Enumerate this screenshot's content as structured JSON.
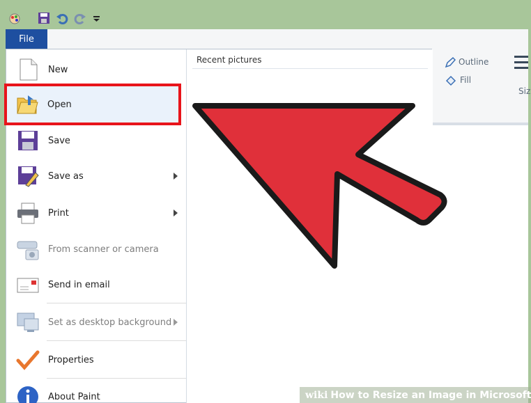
{
  "window": {
    "file_tab": "File"
  },
  "ribbon": {
    "outline_label": "Outline",
    "fill_label": "Fill",
    "size_label": "Siz"
  },
  "menu": {
    "items": [
      {
        "label": "New",
        "icon": "new-document-icon"
      },
      {
        "label": "Open",
        "icon": "open-folder-icon"
      },
      {
        "label": "Save",
        "icon": "floppy-disk-icon"
      },
      {
        "label": "Save as",
        "icon": "save-as-icon",
        "submenu": true
      },
      {
        "label": "Print",
        "icon": "printer-icon",
        "submenu": true
      },
      {
        "label": "From scanner or camera",
        "icon": "scanner-icon",
        "disabled": true
      },
      {
        "label": "Send in email",
        "icon": "email-icon"
      },
      {
        "label": "Set as desktop background",
        "icon": "desktop-icon",
        "submenu": true,
        "disabled": true
      },
      {
        "label": "Properties",
        "icon": "checkmark-icon"
      },
      {
        "label": "About Paint",
        "icon": "info-icon"
      }
    ],
    "recent_title": "Recent pictures"
  },
  "watermark": {
    "brand": "wiki",
    "text": "How to Resize an Image in Microsoft Paint"
  },
  "colors": {
    "file_tab": "#1e4fa0",
    "highlight_border": "#e8141b",
    "arrow_fill": "#e0303a",
    "frame": "#a8c69a"
  }
}
